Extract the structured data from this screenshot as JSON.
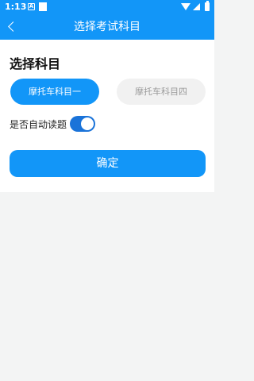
{
  "status_bar": {
    "time": "1:13",
    "notification_letter": "A"
  },
  "header": {
    "title": "选择考试科目"
  },
  "section": {
    "title": "选择科目"
  },
  "subjects": [
    {
      "label": "摩托车科目一",
      "selected": true
    },
    {
      "label": "摩托车科目四",
      "selected": false
    }
  ],
  "auto_read": {
    "label": "是否自动读题",
    "enabled": true
  },
  "confirm": {
    "label": "确定"
  },
  "colors": {
    "primary": "#1296f8",
    "toggle": "#1a73d9",
    "background": "#f3f4f4"
  }
}
